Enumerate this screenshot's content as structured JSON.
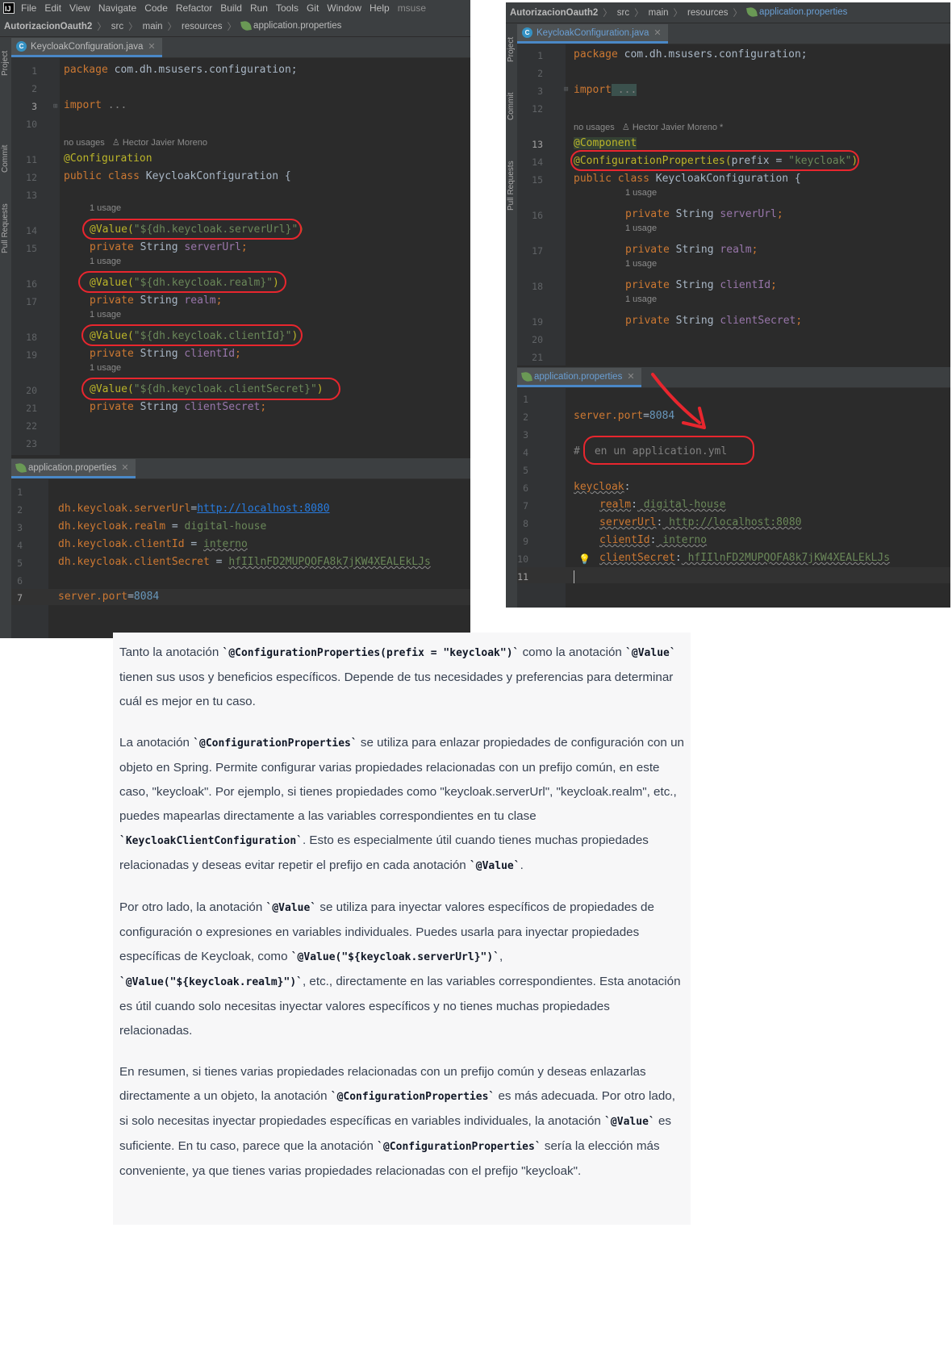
{
  "left_ide": {
    "menu": [
      "File",
      "Edit",
      "View",
      "Navigate",
      "Code",
      "Refactor",
      "Build",
      "Run",
      "Tools",
      "Git",
      "Window",
      "Help"
    ],
    "menu_project": "msuse",
    "breadcrumb": [
      "AutorizacionOauth2",
      "src",
      "main",
      "resources",
      "application.properties"
    ],
    "side_panels": [
      "Project",
      "Commit",
      "Pull Requests"
    ],
    "tab_java": "KeycloakConfiguration.java",
    "tab_props": "application.properties",
    "java_line_numbers": [
      "1",
      "2",
      "3",
      "10",
      "11",
      "12",
      "13",
      "14",
      "15",
      "16",
      "17",
      "18",
      "19",
      "20",
      "21",
      "22",
      "23"
    ],
    "java_code": {
      "l1_kw": "package",
      "l1_rest": " com.dh.msusers.configuration;",
      "l3_kw": "import",
      "l3_rest": " ...",
      "usage_author": "no usages   ♙ Hector Javier Moreno",
      "l11": "@Configuration",
      "l12_kw": "public class",
      "l12_rest": " KeycloakConfiguration {",
      "usage": "1 usage",
      "value_ann": "@Value(",
      "v1": "\"${dh.keycloak.serverUrl}\"",
      "v2": "\"${dh.keycloak.realm}\"",
      "v3": "\"${dh.keycloak.clientId}\"",
      "v4": "\"${dh.keycloak.clientSecret}\"",
      "close_paren": ")",
      "priv_kw": "private",
      "string_type": " String ",
      "f1": "serverUrl",
      "f2": "realm",
      "f3": "clientId",
      "f4": "clientSecret",
      "semi": ";"
    },
    "props_line_numbers": [
      "1",
      "2",
      "3",
      "4",
      "5",
      "6",
      "7"
    ],
    "props": {
      "k1": "dh.keycloak.serverUrl",
      "eq1": "=",
      "v1": "http://localhost:8080",
      "k2": "dh.keycloak.realm",
      "eq2": " = ",
      "v2": "digital-house",
      "k3": "dh.keycloak.clientId",
      "eq3": " = ",
      "v3": "interno",
      "k4": "dh.keycloak.clientSecret",
      "eq4": " = ",
      "v4": "hfIIlnFD2MUPQOFA8k7jKW4XEALEkLJs",
      "k7": "server.port",
      "eq7": "=",
      "v7": "8084"
    }
  },
  "right_ide": {
    "breadcrumb": [
      "AutorizacionOauth2",
      "src",
      "main",
      "resources",
      "application.properties"
    ],
    "side_panels": [
      "Project",
      "Commit",
      "Pull Requests"
    ],
    "tab_java": "KeycloakConfiguration.java",
    "tab_props": "application.properties",
    "java_line_numbers": [
      "1",
      "2",
      "3",
      "12",
      "13",
      "14",
      "15",
      "16",
      "17",
      "18",
      "19",
      "20",
      "21"
    ],
    "java_code": {
      "l1_kw": "package",
      "l1_rest": " com.dh.msusers.configuration;",
      "l3_kw": "import",
      "l3_rest": " ...",
      "usage_author": "no usages   ♙ Hector Javier Moreno *",
      "l13": "@Component",
      "l14_ann": "@ConfigurationProperties(",
      "l14_mid": "prefix = ",
      "l14_str": "\"keycloak\"",
      "l14_end": ")",
      "l15_kw": "public class",
      "l15_rest": " KeycloakConfiguration {",
      "usage": "1 usage",
      "priv_kw": "private",
      "string_type": " String ",
      "f1": "serverUrl",
      "f2": "realm",
      "f3": "clientId",
      "f4": "clientSecret",
      "semi": ";"
    },
    "yml_line_numbers": [
      "1",
      "2",
      "3",
      "4",
      "5",
      "6",
      "7",
      "8",
      "9",
      "10",
      "11"
    ],
    "yml": {
      "port_key": "server.port",
      "port_eq": "=",
      "port_val": "8084",
      "hash": "#",
      "comment": "en un application.yml",
      "root": "keycloak",
      "colon": ":",
      "k1": "realm",
      "v1": " digital-house",
      "k2": "serverUrl",
      "v2": " http://localhost:8080",
      "k3": "clientId",
      "v3": " interno",
      "k4": "clientSecret",
      "v4": " hfIIlnFD2MUPQOFA8k7jKW4XEALEkLJs"
    }
  },
  "answer": {
    "p1": [
      "Tanto la anotación ",
      "`@ConfigurationProperties(prefix = \"keycloak\")`",
      " como la anotación ",
      "`@Value`",
      " tienen sus usos y beneficios específicos. Depende de tus necesidades y preferencias para determinar cuál es mejor en tu caso."
    ],
    "p2": [
      "La anotación ",
      "`@ConfigurationProperties`",
      " se utiliza para enlazar propiedades de configuración con un objeto en Spring. Permite configurar varias propiedades relacionadas con un prefijo común, en este caso, \"keycloak\". Por ejemplo, si tienes propiedades como \"keycloak.serverUrl\", \"keycloak.realm\", etc., puedes mapearlas directamente a las variables correspondientes en tu clase ",
      "`KeycloakClientConfiguration`",
      ". Esto es especialmente útil cuando tienes muchas propiedades relacionadas y deseas evitar repetir el prefijo en cada anotación ",
      "`@Value`",
      "."
    ],
    "p3": [
      "Por otro lado, la anotación ",
      "`@Value`",
      " se utiliza para inyectar valores específicos de propiedades de configuración o expresiones en variables individuales. Puedes usarla para inyectar propiedades específicas de Keycloak, como ",
      "`@Value(\"${keycloak.serverUrl}\")`",
      ", ",
      "`@Value(\"${keycloak.realm}\")`",
      ", etc., directamente en las variables correspondientes. Esta anotación es útil cuando solo necesitas inyectar valores específicos y no tienes muchas propiedades relacionadas."
    ],
    "p4": [
      "En resumen, si tienes varias propiedades relacionadas con un prefijo común y deseas enlazarlas directamente a un objeto, la anotación ",
      "`@ConfigurationProperties`",
      " es más adecuada. Por otro lado, si solo necesitas inyectar propiedades específicas en variables individuales, la anotación ",
      "`@Value`",
      " es suficiente. En tu caso, parece que la anotación ",
      "`@ConfigurationProperties`",
      " sería la elección más conveniente, ya que tienes varias propiedades relacionadas con el prefijo \"keycloak\"."
    ]
  },
  "colors": {
    "editor_bg": "#2b2b2b",
    "keyword": "#cc7832",
    "annotation": "#bbb529",
    "string": "#6a8759",
    "field": "#9876aa",
    "number": "#6897bb",
    "highlight_red": "#e8262e",
    "answer_bg": "#f7f7f8"
  }
}
